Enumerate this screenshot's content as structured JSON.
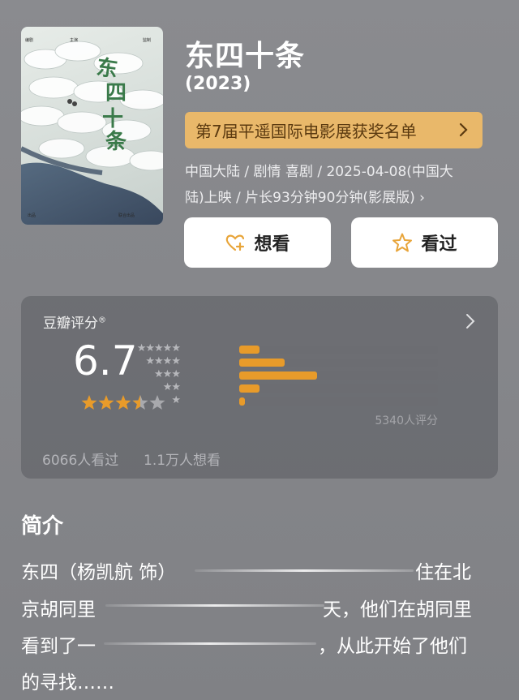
{
  "movie": {
    "title": "东四十条",
    "year": "(2023)",
    "award": "第7届平遥国际电影展获奖名单",
    "meta_line1": "中国大陆 / 剧情 喜剧 / 2025-04-08(中国大",
    "meta_line2": "陆)上映 / 片长93分钟90分钟(影展版) ›",
    "poster": {
      "title_art": "东四十条"
    }
  },
  "actions": {
    "want_label": "想看",
    "seen_label": "看过"
  },
  "rating": {
    "label": "豆瓣评分",
    "trademark": "®",
    "score": "6.7",
    "star_text": "★★★★★",
    "vote_count": "5340人评分",
    "distribution": [
      {
        "stars": "★★★★★",
        "percent": 10
      },
      {
        "stars": "★★★★",
        "percent": 23
      },
      {
        "stars": "★★★",
        "percent": 39
      },
      {
        "stars": "★★",
        "percent": 10
      },
      {
        "stars": "★",
        "percent": 3
      }
    ],
    "watched": "6066人看过",
    "wanted": "1.1万人想看"
  },
  "intro": {
    "title": "简介",
    "line1_a": "东四（杨凯航 饰）",
    "line1_b": "住在北",
    "line2_a": "京胡同里",
    "line2_b": "天，他们在胡同里",
    "line3_a": "看到了一",
    "line3_b": "，从此开始了他们",
    "line4": "的寻找……"
  },
  "colors": {
    "accent": "#e89b2a",
    "award_bg": "#e9b86a",
    "background": "#87888c"
  }
}
